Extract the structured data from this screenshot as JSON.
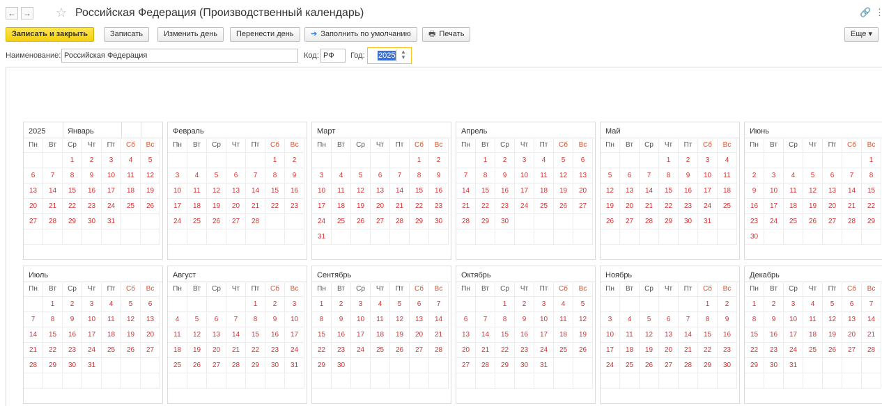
{
  "window": {
    "title": "Российская Федерация (Производственный календарь)",
    "back_icon": "arrow-left-icon",
    "forward_icon": "arrow-right-icon",
    "favorite_icon": "star-icon",
    "link_icon": "link-icon"
  },
  "toolbar": {
    "save_close": "Записать и закрыть",
    "save": "Записать",
    "change_day": "Изменить день",
    "move_day": "Перенести день",
    "fill_default": "Заполнить по умолчанию",
    "print": "Печать",
    "more": "Еще"
  },
  "form": {
    "name_label": "Наименование:",
    "name_value": "Российская Федерация",
    "code_label": "Код:",
    "code_value": "РФ",
    "year_label": "Год:",
    "year_value": "2025"
  },
  "calendar": {
    "year": "2025",
    "weekdays": [
      "Пн",
      "Вт",
      "Ср",
      "Чт",
      "Пт",
      "Сб",
      "Вс"
    ],
    "months": [
      {
        "name": "Январь",
        "offset": 2,
        "days": 31
      },
      {
        "name": "Февраль",
        "offset": 5,
        "days": 28
      },
      {
        "name": "Март",
        "offset": 5,
        "days": 31
      },
      {
        "name": "Апрель",
        "offset": 1,
        "days": 30
      },
      {
        "name": "Май",
        "offset": 3,
        "days": 31
      },
      {
        "name": "Июнь",
        "offset": 6,
        "days": 30
      },
      {
        "name": "Июль",
        "offset": 1,
        "days": 31
      },
      {
        "name": "Август",
        "offset": 4,
        "days": 31
      },
      {
        "name": "Сентябрь",
        "offset": 0,
        "days": 30
      },
      {
        "name": "Октябрь",
        "offset": 2,
        "days": 31
      },
      {
        "name": "Ноябрь",
        "offset": 5,
        "days": 30
      },
      {
        "name": "Декабрь",
        "offset": 0,
        "days": 31
      }
    ]
  },
  "colors": {
    "weekend_header": "#e0522d",
    "day_text": "#d63232",
    "primary_button": "#f4cf13",
    "year_focus": "#f5c518"
  }
}
